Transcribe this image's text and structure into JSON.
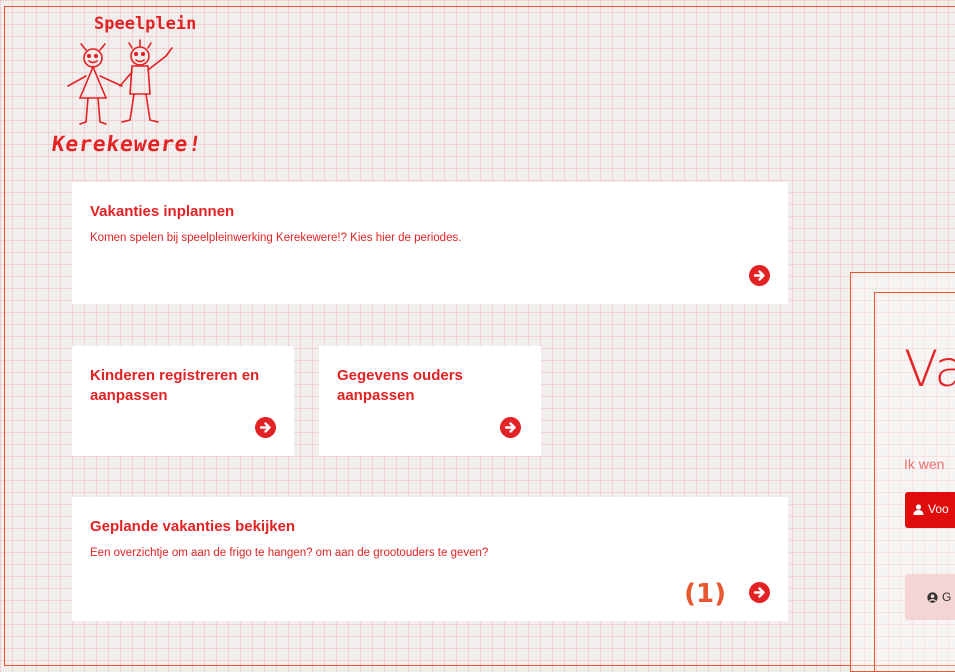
{
  "logo": {
    "line1": "Speelplein",
    "line2": "Kerekewere!"
  },
  "cards": [
    {
      "title": "Vakanties inplannen",
      "text": "Komen spelen bij speelpleinwerking Kerekewere!? Kies hier de periodes."
    },
    {
      "title": "Kinderen registreren en aanpassen",
      "text": ""
    },
    {
      "title": "Gegevens ouders aanpassen",
      "text": ""
    },
    {
      "title": "Geplande vakanties bekijken",
      "text": "Een overzichtje om aan de frigo te hangen? om aan de grootouders te geven?",
      "count": "(1)"
    }
  ],
  "side_panel": {
    "title": "Va",
    "subtitle": "Ik wen",
    "button_primary": "Voo",
    "button_secondary": "G"
  },
  "colors": {
    "accent": "#e32224",
    "orange": "#e8572f"
  },
  "icons": [
    "arrow-right-circle-icon",
    "user-icon",
    "user-circle-icon"
  ]
}
